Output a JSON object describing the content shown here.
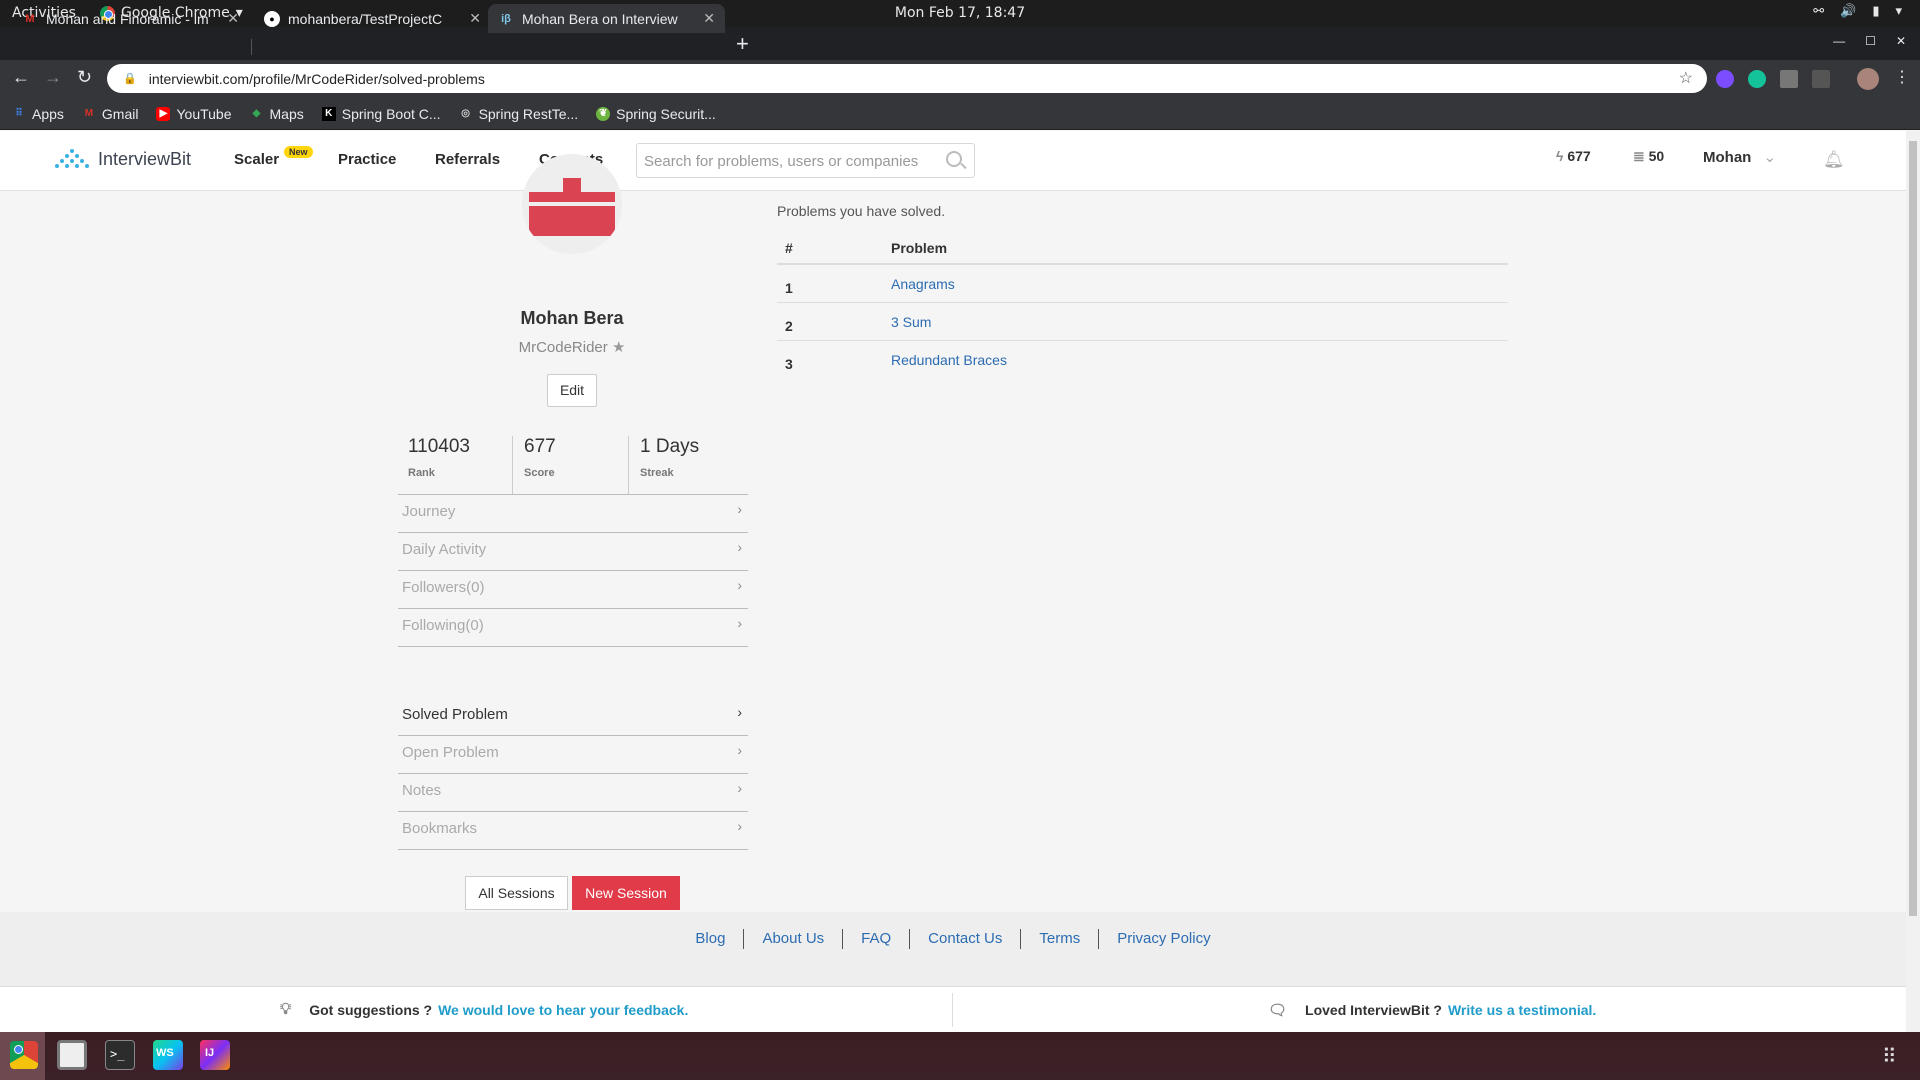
{
  "system": {
    "activities": "Activities",
    "app_name": "Google Chrome",
    "clock": "Mon Feb 17, 18:47"
  },
  "tabs": [
    {
      "title": "Mohan and Finoramic - im",
      "favicon": "gmail-icon"
    },
    {
      "title": "mohanbera/TestProjectC",
      "favicon": "github-icon"
    },
    {
      "title": "Mohan Bera on Interview",
      "favicon": "interviewbit-icon",
      "active": true
    }
  ],
  "address_bar": {
    "url": "interviewbit.com/profile/MrCodeRider/solved-problems"
  },
  "bookmarks": [
    {
      "label": "Apps",
      "icon": "apps-grid-icon"
    },
    {
      "label": "Gmail",
      "icon": "gmail-icon"
    },
    {
      "label": "YouTube",
      "icon": "youtube-icon"
    },
    {
      "label": "Maps",
      "icon": "maps-icon"
    },
    {
      "label": "Spring Boot C...",
      "icon": "k-icon"
    },
    {
      "label": "Spring RestTe...",
      "icon": "compass-icon"
    },
    {
      "label": "Spring Securit...",
      "icon": "leaf-icon"
    }
  ],
  "site": {
    "logo_text": "InterviewBit",
    "nav": {
      "scaler": "Scaler",
      "new_badge": "New",
      "practice": "Practice",
      "referrals": "Referrals",
      "contests": "Contests"
    },
    "search_placeholder": "Search for problems, users or companies",
    "header_score": "677",
    "header_coins": "50",
    "user_menu": "Mohan"
  },
  "profile": {
    "name": "Mohan Bera",
    "username": "MrCodeRider",
    "edit_label": "Edit",
    "stats": [
      {
        "value": "110403",
        "label": "Rank"
      },
      {
        "value": "677",
        "label": "Score"
      },
      {
        "value": "1 Days",
        "label": "Streak"
      }
    ],
    "menu1": [
      "Journey",
      "Daily Activity",
      "Followers(0)",
      "Following(0)"
    ],
    "menu2": [
      "Solved Problem",
      "Open Problem",
      "Notes",
      "Bookmarks"
    ],
    "all_sessions": "All Sessions",
    "new_session": "New Session"
  },
  "solved": {
    "title": "Problems you have solved.",
    "columns": [
      "#",
      "Problem"
    ],
    "rows": [
      {
        "num": "1",
        "problem": "Anagrams"
      },
      {
        "num": "2",
        "problem": "3 Sum"
      },
      {
        "num": "3",
        "problem": "Redundant Braces"
      }
    ]
  },
  "footer": {
    "links": [
      "Blog",
      "About Us",
      "FAQ",
      "Contact Us",
      "Terms",
      "Privacy Policy"
    ],
    "suggest_text": "Got suggestions ?",
    "suggest_link": "We would love to hear your feedback.",
    "loved_text": "Loved InterviewBit ?",
    "loved_link": "Write us a testimonial."
  },
  "colors": {
    "accent_red": "#e13a49",
    "link_blue": "#2c6cb3",
    "badge_yellow": "#ffd60a"
  }
}
